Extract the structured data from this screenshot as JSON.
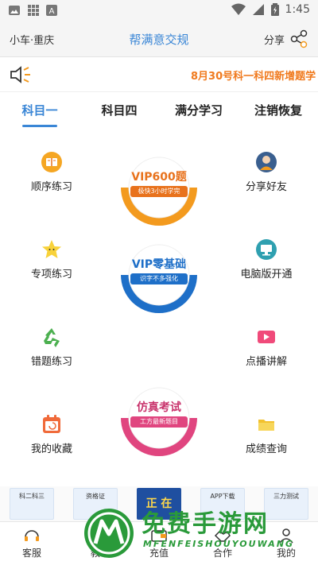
{
  "status_bar": {
    "time": "1:45",
    "icons": [
      "photo-icon",
      "grid-icon",
      "a-badge-icon",
      "wifi-icon",
      "signal-icon",
      "battery-icon"
    ]
  },
  "header": {
    "city": "小车·重庆",
    "title": "帮满意交规",
    "share_label": "分享"
  },
  "notice": {
    "text": "8月30号科一科四新增题学"
  },
  "tabs": [
    {
      "label": "科目一",
      "active": true
    },
    {
      "label": "科目四",
      "active": false
    },
    {
      "label": "满分学习",
      "active": false
    },
    {
      "label": "注销恢复",
      "active": false
    }
  ],
  "left_features": [
    {
      "label": "顺序练习",
      "icon": "book-icon"
    },
    {
      "label": "专项练习",
      "icon": "star-icon"
    },
    {
      "label": "错题练习",
      "icon": "recycle-icon"
    },
    {
      "label": "我的收藏",
      "icon": "calendar-icon"
    }
  ],
  "right_features": [
    {
      "label": "分享好友",
      "icon": "user-avatar-icon"
    },
    {
      "label": "电脑版开通",
      "icon": "computer-icon"
    },
    {
      "label": "点播讲解",
      "icon": "video-icon"
    },
    {
      "label": "成绩查询",
      "icon": "folder-icon"
    }
  ],
  "vip_cards": [
    {
      "title": "VIP600题",
      "subtitle": "极快3小时学完",
      "color": "#f39a1e",
      "title_color": "#e8721c"
    },
    {
      "title": "VIP零基础",
      "subtitle": "识字不多强化",
      "color": "#1e6fc8",
      "title_color": "#1e6fc8"
    },
    {
      "title": "仿真考试",
      "subtitle": "工方最新题目",
      "color": "#e0457f",
      "title_color": "#c8326b"
    }
  ],
  "banners": [
    {
      "label": "科二科三"
    },
    {
      "label": "资格证"
    },
    {
      "label": "正 在"
    },
    {
      "label": "APP下载"
    },
    {
      "label": "三力测试"
    }
  ],
  "bottom_nav": [
    {
      "label": "客服",
      "icon": "headset-icon"
    },
    {
      "label": "教",
      "icon": "book-open-icon"
    },
    {
      "label": "充值",
      "icon": "wallet-icon"
    },
    {
      "label": "合作",
      "icon": "handshake-icon"
    },
    {
      "label": "我的",
      "icon": "person-icon"
    }
  ],
  "watermark": {
    "text": "免费手游网",
    "subtext": "MFENFEISHOUYOUWANG"
  },
  "colors": {
    "accent": "#3a86d6",
    "notice": "#f07a1e"
  }
}
